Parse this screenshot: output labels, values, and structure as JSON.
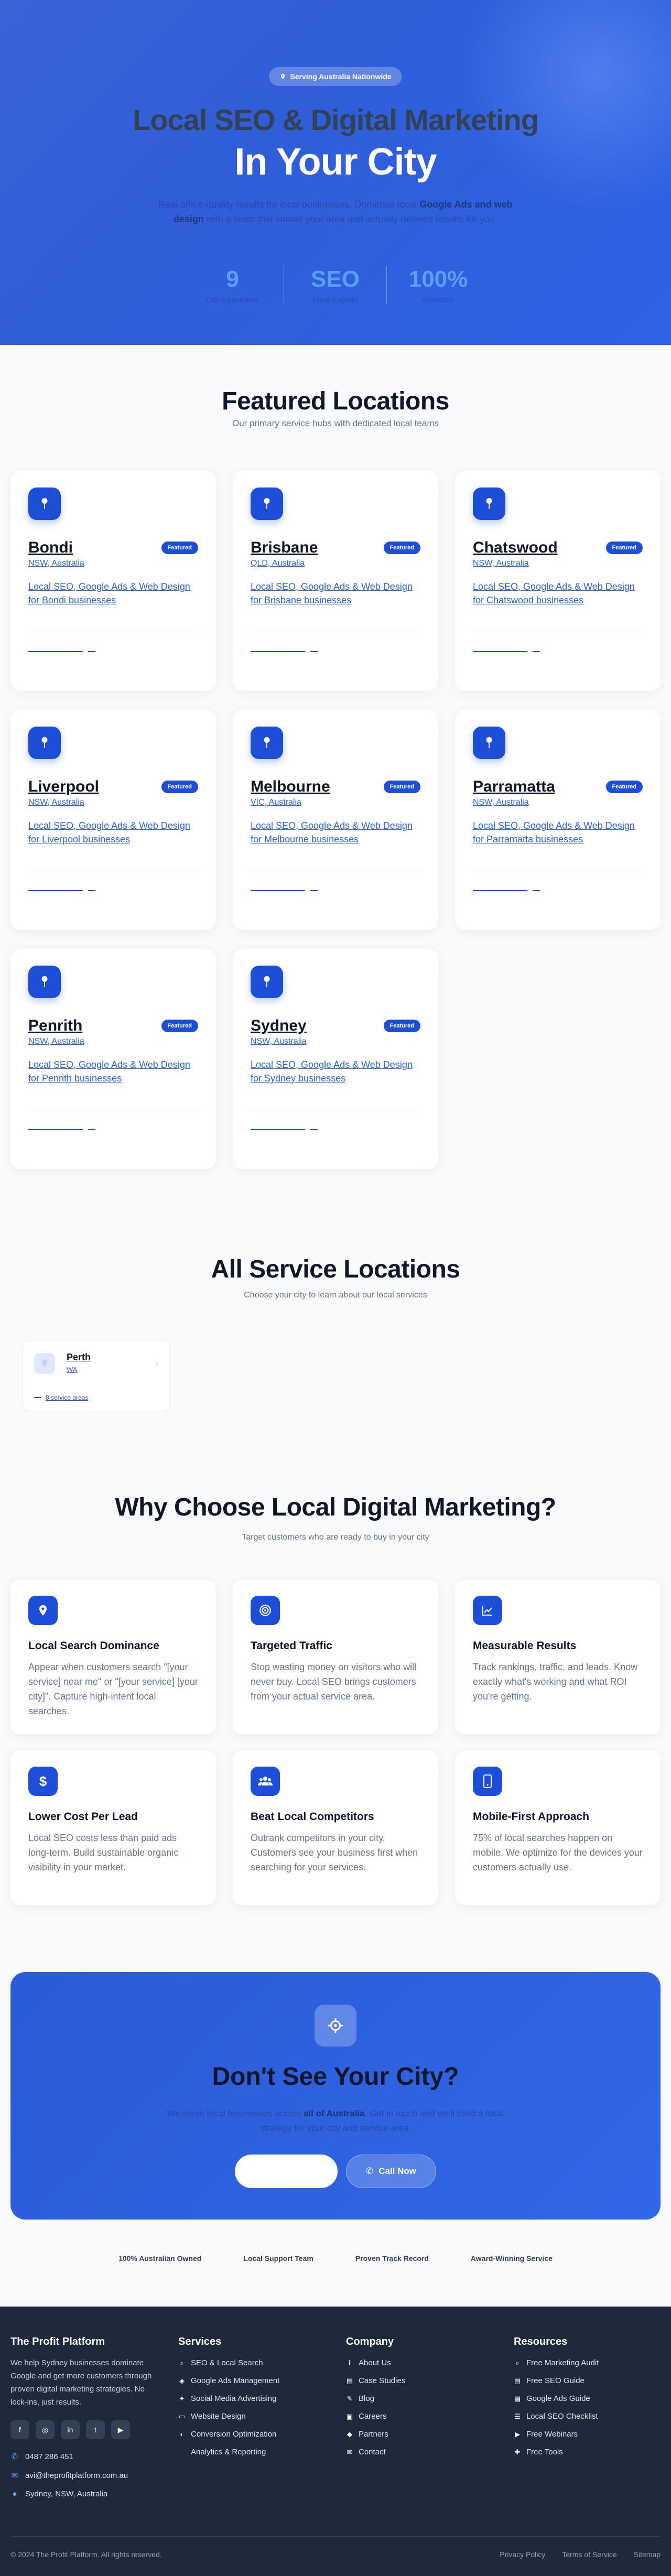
{
  "hero": {
    "badge": "Serving Australia Nationwide",
    "title_line1": "Local SEO & Digital Marketing",
    "title_line2": "In Your City",
    "subtitle_pre": "Real office-quality results for local businesses. Dominate local",
    "subtitle_bold": "Google Ads and web design",
    "subtitle_post": "with a team that knows your area and actually delivers results for you.",
    "stats": [
      {
        "value": "9",
        "label": "Office Locations"
      },
      {
        "value": "SEO",
        "label": "Local Experts"
      },
      {
        "value": "100%",
        "label": "Australian"
      }
    ]
  },
  "featured": {
    "title": "Featured Locations",
    "subtitle": "Our primary service hubs with dedicated local teams",
    "badge_label": "Featured",
    "locations": [
      {
        "name": "Bondi",
        "state": "NSW, Australia",
        "desc": "Local SEO, Google Ads & Web Design for Bondi businesses"
      },
      {
        "name": "Brisbane",
        "state": "QLD, Australia",
        "desc": "Local SEO, Google Ads & Web Design for Brisbane businesses"
      },
      {
        "name": "Chatswood",
        "state": "NSW, Australia",
        "desc": "Local SEO, Google Ads & Web Design for Chatswood businesses"
      },
      {
        "name": "Liverpool",
        "state": "NSW, Australia",
        "desc": "Local SEO, Google Ads & Web Design for Liverpool businesses"
      },
      {
        "name": "Melbourne",
        "state": "VIC, Australia",
        "desc": "Local SEO, Google Ads & Web Design for Melbourne businesses"
      },
      {
        "name": "Parramatta",
        "state": "NSW, Australia",
        "desc": "Local SEO, Google Ads & Web Design for Parramatta businesses"
      },
      {
        "name": "Penrith",
        "state": "NSW, Australia",
        "desc": "Local SEO, Google Ads & Web Design for Penrith businesses"
      },
      {
        "name": "Sydney",
        "state": "NSW, Australia",
        "desc": "Local SEO, Google Ads & Web Design for Sydney businesses"
      }
    ]
  },
  "all_locations": {
    "title": "All Service Locations",
    "subtitle": "Choose your city to learn about our local services",
    "city": {
      "name": "Perth",
      "state": "WA",
      "areas": "8 service areas"
    }
  },
  "why": {
    "title": "Why Choose Local Digital Marketing?",
    "subtitle": "Target customers who are ready to buy in your city",
    "cards": [
      {
        "icon": "map-pin-icon",
        "title": "Local Search Dominance",
        "text": "Appear when customers search \"[your service] near me\" or \"[your service] [your city]\". Capture high-intent local searches."
      },
      {
        "icon": "target-icon",
        "title": "Targeted Traffic",
        "text": "Stop wasting money on visitors who will never buy. Local SEO brings customers from your actual service area."
      },
      {
        "icon": "chart-icon",
        "title": "Measurable Results",
        "text": "Track rankings, traffic, and leads. Know exactly what's working and what ROI you're getting."
      },
      {
        "icon": "dollar-icon",
        "title": "Lower Cost Per Lead",
        "text": "Local SEO costs less than paid ads long-term. Build sustainable organic visibility in your market."
      },
      {
        "icon": "users-icon",
        "title": "Beat Local Competitors",
        "text": "Outrank competitors in your city. Customers see your business first when searching for your services."
      },
      {
        "icon": "mobile-icon",
        "title": "Mobile-First Approach",
        "text": "75% of local searches happen on mobile. We optimize for the devices your customers actually use."
      }
    ]
  },
  "cta": {
    "title": "Don't See Your City?",
    "text_pre": "We serve local businesses across",
    "text_bold": "all of Australia",
    "text_post": ". Get in touch and we'll build a local strategy for your city and service area.",
    "call_label": "Call Now"
  },
  "trust": [
    "100% Australian Owned",
    "Local Support Team",
    "Proven Track Record",
    "Award-Winning Service"
  ],
  "footer": {
    "brand": "The Profit Platform",
    "desc": "We help Sydney businesses dominate Google and get more customers through proven digital marketing strategies. No lock-ins, just results.",
    "socials": [
      "f",
      "◎",
      "in",
      "t",
      "▶"
    ],
    "phone": "0487 286 451",
    "email": "avi@theprofitplatform.com.au",
    "address": "Sydney, NSW, Australia",
    "services_title": "Services",
    "services": [
      {
        "icon": "⌕",
        "label": "SEO & Local Search"
      },
      {
        "icon": "◈",
        "label": "Google Ads Management"
      },
      {
        "icon": "✦",
        "label": "Social Media Advertising"
      },
      {
        "icon": "▭",
        "label": "Website Design"
      },
      {
        "icon": "◐",
        "label": "Conversion Optimization"
      },
      {
        "icon": "",
        "label": "Analytics & Reporting"
      }
    ],
    "company_title": "Company",
    "company": [
      {
        "icon": "ℹ",
        "label": "About Us"
      },
      {
        "icon": "▤",
        "label": "Case Studies"
      },
      {
        "icon": "✎",
        "label": "Blog"
      },
      {
        "icon": "▣",
        "label": "Careers"
      },
      {
        "icon": "◆",
        "label": "Partners"
      },
      {
        "icon": "✉",
        "label": "Contact"
      }
    ],
    "resources_title": "Resources",
    "resources": [
      {
        "icon": "⌕",
        "label": "Free Marketing Audit"
      },
      {
        "icon": "▤",
        "label": "Free SEO Guide"
      },
      {
        "icon": "▤",
        "label": "Google Ads Guide"
      },
      {
        "icon": "☰",
        "label": "Local SEO Checklist"
      },
      {
        "icon": "▶",
        "label": "Free Webinars"
      },
      {
        "icon": "✚",
        "label": "Free Tools"
      }
    ],
    "copyright": "© 2024 The Profit Platform. All rights reserved.",
    "bottom_links": [
      "Privacy Policy",
      "Terms of Service",
      "Sitemap"
    ]
  }
}
